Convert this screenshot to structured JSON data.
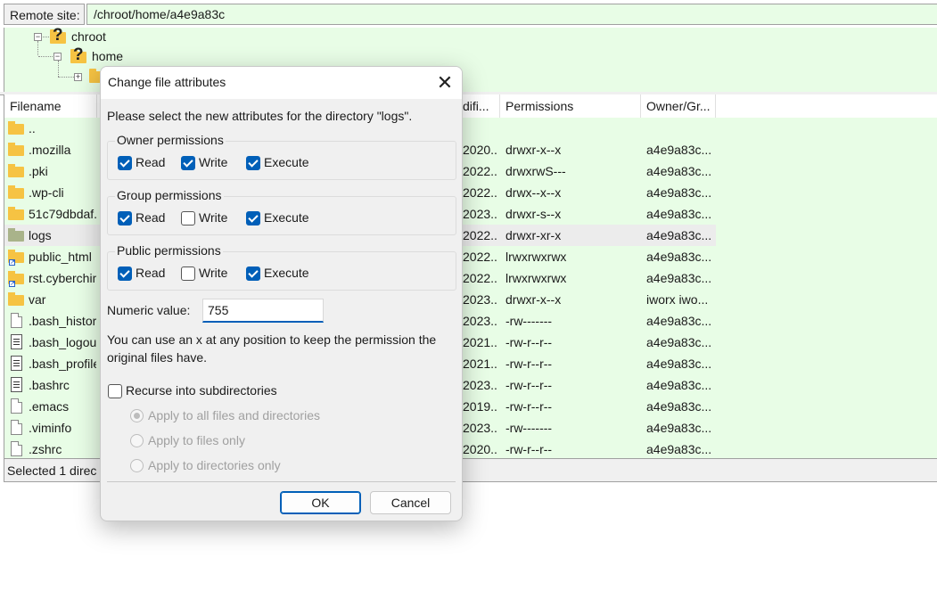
{
  "remote_site": {
    "label": "Remote site:",
    "path": "/chroot/home/a4e9a83c"
  },
  "tree": {
    "items": [
      {
        "label": "chroot"
      },
      {
        "label": "home"
      }
    ]
  },
  "file_list": {
    "columns": [
      "Filename",
      "difi...",
      "Permissions",
      "Owner/Gr..."
    ],
    "rows": [
      {
        "name": "..",
        "date": "",
        "perms": "",
        "owner": "",
        "icon": "folder"
      },
      {
        "name": ".mozilla",
        "date": "2020...",
        "perms": "drwxr-x--x",
        "owner": "a4e9a83c...",
        "icon": "folder"
      },
      {
        "name": ".pki",
        "date": "2022...",
        "perms": "drwxrwS---",
        "owner": "a4e9a83c...",
        "icon": "folder"
      },
      {
        "name": ".wp-cli",
        "date": "2022...",
        "perms": "drwx--x--x",
        "owner": "a4e9a83c...",
        "icon": "folder"
      },
      {
        "name": "51c79dbdaf...",
        "date": "2023...",
        "perms": "drwxr-s--x",
        "owner": "a4e9a83c...",
        "icon": "folder"
      },
      {
        "name": "logs",
        "date": "2022...",
        "perms": "drwxr-xr-x",
        "owner": "a4e9a83c...",
        "icon": "folder-grey"
      },
      {
        "name": "public_html",
        "date": "2022...",
        "perms": "lrwxrwxrwx",
        "owner": "a4e9a83c...",
        "icon": "folder-link"
      },
      {
        "name": "rst.cyberchimps...",
        "date": "2022...",
        "perms": "lrwxrwxrwx",
        "owner": "a4e9a83c...",
        "icon": "folder-link"
      },
      {
        "name": "var",
        "date": "2023...",
        "perms": "drwxr-x--x",
        "owner": "iworx iwo...",
        "icon": "folder"
      },
      {
        "name": ".bash_history",
        "date": "2023...",
        "perms": "-rw-------",
        "owner": "a4e9a83c...",
        "icon": "file"
      },
      {
        "name": ".bash_logout",
        "date": "2021...",
        "perms": "-rw-r--r--",
        "owner": "a4e9a83c...",
        "icon": "textfile"
      },
      {
        "name": ".bash_profile",
        "date": "2021...",
        "perms": "-rw-r--r--",
        "owner": "a4e9a83c...",
        "icon": "textfile"
      },
      {
        "name": ".bashrc",
        "date": "2023...",
        "perms": "-rw-r--r--",
        "owner": "a4e9a83c...",
        "icon": "textfile"
      },
      {
        "name": ".emacs",
        "date": "2019...",
        "perms": "-rw-r--r--",
        "owner": "a4e9a83c...",
        "icon": "file"
      },
      {
        "name": ".viminfo",
        "date": "2023...",
        "perms": "-rw-------",
        "owner": "a4e9a83c...",
        "icon": "file"
      },
      {
        "name": ".zshrc",
        "date": "2020...",
        "perms": "-rw-r--r--",
        "owner": "a4e9a83c...",
        "icon": "file"
      }
    ]
  },
  "status_bar": {
    "text": "Selected 1 direc"
  },
  "dialog": {
    "title": "Change file attributes",
    "close_icon": "close-icon",
    "instructions": "Please select the new attributes for the directory \"logs\".",
    "groups": {
      "owner": {
        "label": "Owner permissions",
        "read": "Read",
        "write": "Write",
        "execute": "Execute",
        "checked": [
          true,
          true,
          true
        ]
      },
      "group": {
        "label": "Group permissions",
        "read": "Read",
        "write": "Write",
        "execute": "Execute",
        "checked": [
          true,
          false,
          true
        ]
      },
      "public": {
        "label": "Public permissions",
        "read": "Read",
        "write": "Write",
        "execute": "Execute",
        "checked": [
          true,
          false,
          true
        ]
      }
    },
    "numeric_label": "Numeric value:",
    "numeric_value": "755",
    "hint_line1": "You can use an x at any position to keep the permission the",
    "hint_line2": "original files have.",
    "recurse_label": "Recurse into subdirectories",
    "recurse_checked": false,
    "apply_all": "Apply to all files and directories",
    "apply_files": "Apply to files only",
    "apply_dirs": "Apply to directories only",
    "ok": "OK",
    "cancel": "Cancel",
    "accent_color": "#005fb8",
    "list_bg_color": "#e8fde6"
  }
}
